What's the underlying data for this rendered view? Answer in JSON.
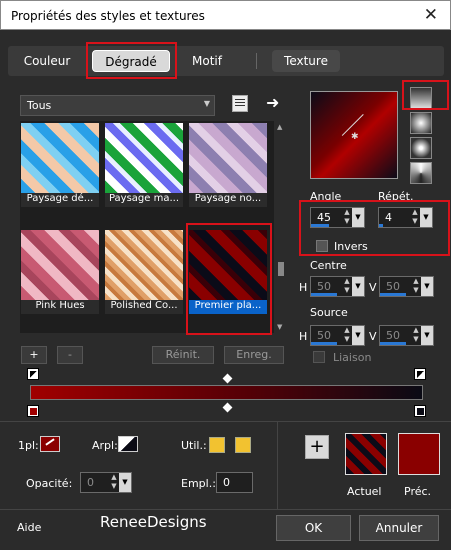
{
  "window": {
    "title": "Propriétés des styles et textures",
    "close": "✕"
  },
  "tabs": {
    "couleur": "Couleur",
    "degrade": "Dégradé",
    "motif": "Motif",
    "texture": "Texture"
  },
  "category": {
    "value": "Tous"
  },
  "gallery": [
    {
      "label": "Paysage dé..."
    },
    {
      "label": "Paysage ma..."
    },
    {
      "label": "Paysage no..."
    },
    {
      "label": "Pink Hues"
    },
    {
      "label": "Polished Co..."
    },
    {
      "label": "Premier pla..."
    }
  ],
  "gallery_buttons": {
    "add": "+",
    "remove": "-",
    "reset": "Réinit.",
    "save": "Enreg."
  },
  "gradient": {
    "angle_label": "Angle",
    "angle": "45",
    "repeat_label": "Répét.",
    "repeat": "4",
    "invert_label": "Invers",
    "center_label": "Centre",
    "center_h_label": "H",
    "center_h": "50",
    "center_v_label": "V",
    "center_v": "50",
    "source_label": "Source",
    "source_h_label": "H",
    "source_h": "50",
    "source_v_label": "V",
    "source_v": "50",
    "link_label": "Liaison"
  },
  "bottom": {
    "fg_label": "1pl:",
    "bg_label": "Arpl:",
    "util_label": "Util.:",
    "opacity_label": "Opacité:",
    "opacity": "0",
    "location_label": "Empl.:",
    "location": "0",
    "actuel_label": "Actuel",
    "prec_label": "Préc.",
    "help": "Aide",
    "ok": "OK",
    "cancel": "Annuler",
    "plus": "+"
  },
  "watermark": "ReneeDesigns",
  "colors": {
    "accent_red": "#8a0000",
    "selection_blue": "#0a63c9"
  }
}
